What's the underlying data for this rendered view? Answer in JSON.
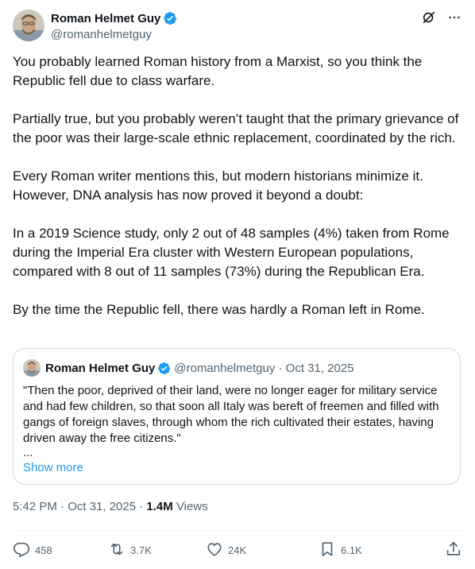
{
  "tweet": {
    "author": {
      "name": "Roman Helmet Guy",
      "handle": "@romanhelmetguy"
    },
    "paragraphs": [
      "You probably learned Roman history from a Marxist, so you think the Republic fell due to class warfare.",
      "Partially true, but you probably weren’t taught that the primary grievance of the poor was their large-scale ethnic replacement, coordinated by the rich.",
      "Every Roman writer mentions this, but modern historians minimize it. However, DNA analysis has now proved it beyond a doubt:",
      "In a 2019 Science study, only 2 out of 48 samples (4%) taken from Rome during the Imperial Era cluster with Western European populations, compared with 8 out of 11 samples (73%) during the Republican Era.",
      "By the time the Republic fell, there was hardly a Roman left in Rome."
    ],
    "quote": {
      "name": "Roman Helmet Guy",
      "handle_date": "@romanhelmetguy · Oct 31, 2025",
      "text": "\"Then the poor, deprived of their land, were no longer eager for military service and had few children, so that soon all Italy was bereft of freemen and filled with gangs of foreign slaves, through whom the rich cultivated their estates, having driven away the free citizens.\"",
      "ellipsis": "...",
      "show_more": "Show more"
    },
    "timestamp": "5:42 PM · Oct 31, 2025 · ",
    "views_count": "1.4M",
    "views_label": " Views",
    "actions": {
      "replies": "458",
      "reposts": "3.7K",
      "likes": "24K",
      "bookmarks": "6.1K"
    }
  },
  "icons": {
    "verified": "verified-badge-icon",
    "grok": "grok-icon",
    "more": "more-icon",
    "reply": "reply-icon",
    "repost": "repost-icon",
    "like": "like-icon",
    "bookmark": "bookmark-icon",
    "share": "share-icon"
  },
  "colors": {
    "verified": "#1d9bf0",
    "link": "#1d9bf0",
    "secondary_text": "#536471",
    "border": "#cfd9de"
  }
}
